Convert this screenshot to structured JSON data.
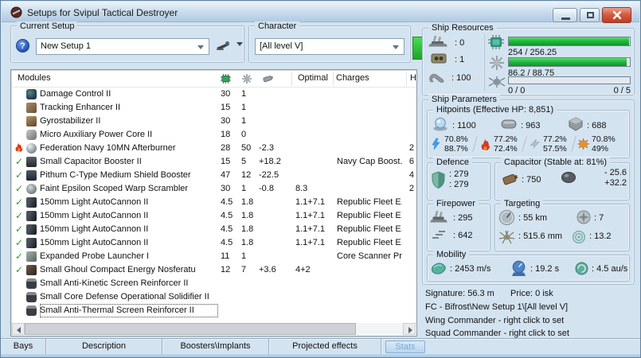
{
  "window": {
    "title": "Setups for Svipul Tactical Destroyer"
  },
  "toolbar": {
    "current_setup": {
      "label": "Current Setup",
      "value": "New Setup 1"
    },
    "character": {
      "label": "Character",
      "value": "[All level V]"
    }
  },
  "modules_table": {
    "title": "Modules",
    "columns": {
      "optimal": "Optimal",
      "charges": "Charges",
      "h": "H"
    },
    "rows": [
      {
        "state": "none",
        "icon": "mi-dc",
        "name": "Damage Control II",
        "cpu": "30",
        "pg": "1"
      },
      {
        "state": "none",
        "icon": "mi-te",
        "name": "Tracking Enhancer II",
        "cpu": "15",
        "pg": "1"
      },
      {
        "state": "none",
        "icon": "mi-gyro",
        "name": "Gyrostabilizer II",
        "cpu": "30",
        "pg": "1"
      },
      {
        "state": "none",
        "icon": "mi-mapc",
        "name": "Micro Auxiliary Power Core II",
        "cpu": "18",
        "pg": "0"
      },
      {
        "state": "overheated",
        "icon": "mi-ab",
        "name": "Federation Navy 10MN Afterburner",
        "cpu": "28",
        "pg": "50",
        "cap": "-2.3",
        "h": "2"
      },
      {
        "state": "active",
        "icon": "mi-cb",
        "name": "Small Capacitor Booster II",
        "cpu": "15",
        "pg": "5",
        "cap": "+18.2",
        "charges": "Navy Cap Boost...",
        "h": "6"
      },
      {
        "state": "active",
        "icon": "mi-sb",
        "name": "Pithum C-Type Medium Shield Booster",
        "cpu": "47",
        "pg": "12",
        "cap": "-22.5",
        "h": "4"
      },
      {
        "state": "active",
        "icon": "mi-ws",
        "name": "Faint Epsilon Scoped Warp Scrambler",
        "cpu": "30",
        "pg": "1",
        "cap": "-0.8",
        "optimal": "8.3",
        "h": "2"
      },
      {
        "state": "active",
        "icon": "mi-ac",
        "name": "150mm Light AutoCannon II",
        "cpu": "4.5",
        "pg": "1.8",
        "optimal": "1.1+7.1",
        "charges": "Republic Fleet E..."
      },
      {
        "state": "active",
        "icon": "mi-ac",
        "name": "150mm Light AutoCannon II",
        "cpu": "4.5",
        "pg": "1.8",
        "optimal": "1.1+7.1",
        "charges": "Republic Fleet E..."
      },
      {
        "state": "active",
        "icon": "mi-ac",
        "name": "150mm Light AutoCannon II",
        "cpu": "4.5",
        "pg": "1.8",
        "optimal": "1.1+7.1",
        "charges": "Republic Fleet E..."
      },
      {
        "state": "active",
        "icon": "mi-ac",
        "name": "150mm Light AutoCannon II",
        "cpu": "4.5",
        "pg": "1.8",
        "optimal": "1.1+7.1",
        "charges": "Republic Fleet E..."
      },
      {
        "state": "active",
        "icon": "mi-pl",
        "name": "Expanded Probe Launcher I",
        "cpu": "11",
        "pg": "1",
        "charges": "Core Scanner Pr..."
      },
      {
        "state": "active",
        "icon": "mi-nos",
        "name": "Small Ghoul Compact Energy Nosferatu",
        "cpu": "12",
        "pg": "7",
        "cap": "+3.6",
        "optimal": "4+2"
      },
      {
        "state": "none",
        "icon": "mi-rig",
        "name": "Small Anti-Kinetic Screen Reinforcer II"
      },
      {
        "state": "none",
        "icon": "mi-rig",
        "name": "Small Core Defense Operational Solidifier II"
      },
      {
        "state": "none",
        "icon": "mi-rig",
        "name": "Small Anti-Thermal Screen Reinforcer II",
        "focused": true
      }
    ]
  },
  "ship_resources": {
    "label": "Ship Resources",
    "turrets": ": 0",
    "launchers": ": 1",
    "calibration": ": 100",
    "cpu": {
      "text": "254 / 256.25",
      "fill": 0.991
    },
    "powergrid": {
      "text": "86.2 / 88.75",
      "fill": 0.971
    },
    "drones": {
      "bandwidth": "0 / 0",
      "count": "0 / 5",
      "fill": 0
    }
  },
  "ship_parameters": {
    "label": "Ship Parameters",
    "hitpoints": {
      "label": "Hitpoints (Effective HP: 8,851)",
      "shield": ": 1100",
      "armor": ": 963",
      "hull": ": 688",
      "resists": [
        {
          "name": "em",
          "top": "70.8%",
          "bottom": "88.7%"
        },
        {
          "name": "thermal",
          "top": "77.2%",
          "bottom": "72.4%"
        },
        {
          "name": "kinetic",
          "top": "77.2%",
          "bottom": "57.5%"
        },
        {
          "name": "explosive",
          "top": "70.8%",
          "bottom": "49%"
        }
      ]
    },
    "defence": {
      "label": "Defence",
      "line1": ": 279",
      "line2": ": 279"
    },
    "capacitor": {
      "label": "Capacitor (Stable at: 81%)",
      "amount": ": 750",
      "drain": "- 25.6",
      "recharge": "+32.2"
    },
    "firepower": {
      "label": "Firepower",
      "dps": ": 295",
      "volley": ": 642"
    },
    "targeting": {
      "label": "Targeting",
      "range": ": 55 km",
      "max_targets": ": 7",
      "scan_resolution": ": 515.6 mm",
      "sensor_strength": ": 13.2"
    },
    "mobility": {
      "label": "Mobility",
      "speed": ": 2453 m/s",
      "align": ": 19.2 s",
      "warp": ": 4.5 au/s"
    }
  },
  "footer": {
    "signature": "Signature: 56.3 m",
    "price": "Price: 0 isk",
    "fc": "FC - Bifrost\\New Setup 1\\[All level V]",
    "wing": "Wing Commander - right click to set",
    "squad": "Squad Commander - right click to set"
  },
  "tabs": [
    {
      "label": "Bays"
    },
    {
      "label": "Description"
    },
    {
      "label": "Boosters\\Implants"
    },
    {
      "label": "Projected effects"
    },
    {
      "label": "Stats"
    }
  ]
}
